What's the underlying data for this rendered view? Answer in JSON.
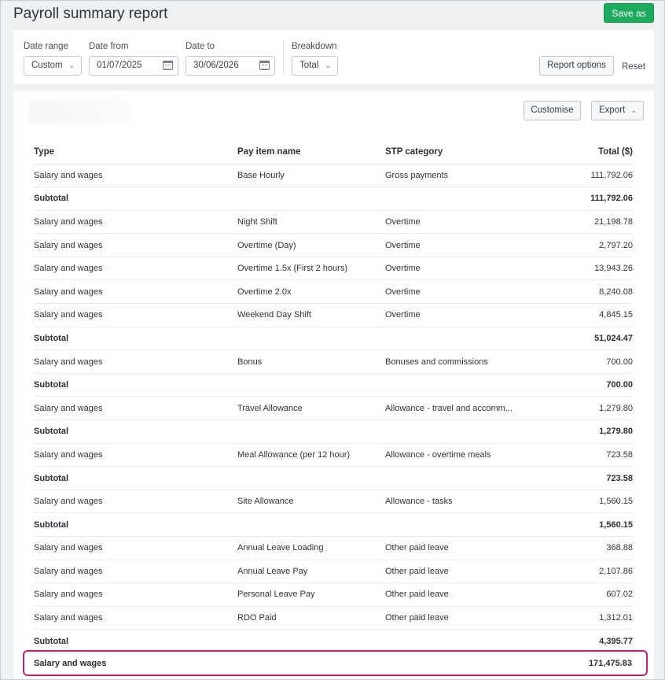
{
  "header": {
    "title": "Payroll summary report",
    "save_label": "Save as"
  },
  "filters": {
    "date_range": {
      "label": "Date range",
      "value": "Custom"
    },
    "date_from": {
      "label": "Date from",
      "value": "01/07/2025"
    },
    "date_to": {
      "label": "Date to",
      "value": "30/06/2026"
    },
    "breakdown": {
      "label": "Breakdown",
      "value": "Total"
    },
    "report_options_label": "Report options",
    "reset_label": "Reset"
  },
  "toolbar": {
    "customise_label": "Customise",
    "export_label": "Export"
  },
  "table": {
    "headers": [
      "Type",
      "Pay item name",
      "STP category",
      "Total ($)"
    ],
    "rows": [
      {
        "kind": "row",
        "type": "Salary and wages",
        "item": "Base Hourly",
        "stp": "Gross payments",
        "total": "111,792.06"
      },
      {
        "kind": "subtotal",
        "type": "Subtotal",
        "item": "",
        "stp": "",
        "total": "111,792.06"
      },
      {
        "kind": "row",
        "type": "Salary and wages",
        "item": "Night Shift",
        "stp": "Overtime",
        "total": "21,198.78"
      },
      {
        "kind": "row",
        "type": "Salary and wages",
        "item": "Overtime (Day)",
        "stp": "Overtime",
        "total": "2,797.20"
      },
      {
        "kind": "row",
        "type": "Salary and wages",
        "item": "Overtime 1.5x (First 2 hours)",
        "stp": "Overtime",
        "total": "13,943.26"
      },
      {
        "kind": "row",
        "type": "Salary and wages",
        "item": "Overtime 2.0x",
        "stp": "Overtime",
        "total": "8,240.08"
      },
      {
        "kind": "row",
        "type": "Salary and wages",
        "item": "Weekend Day Shift",
        "stp": "Overtime",
        "total": "4,845.15"
      },
      {
        "kind": "subtotal",
        "type": "Subtotal",
        "item": "",
        "stp": "",
        "total": "51,024.47"
      },
      {
        "kind": "row",
        "type": "Salary and wages",
        "item": "Bonus",
        "stp": "Bonuses and commissions",
        "total": "700.00"
      },
      {
        "kind": "subtotal",
        "type": "Subtotal",
        "item": "",
        "stp": "",
        "total": "700.00"
      },
      {
        "kind": "row",
        "type": "Salary and wages",
        "item": "Travel Allowance",
        "stp": "Allowance - travel and accomm...",
        "total": "1,279.80"
      },
      {
        "kind": "subtotal",
        "type": "Subtotal",
        "item": "",
        "stp": "",
        "total": "1,279.80"
      },
      {
        "kind": "row",
        "type": "Salary and wages",
        "item": "Meal Allowance (per 12 hour)",
        "stp": "Allowance - overtime meals",
        "total": "723.58"
      },
      {
        "kind": "subtotal",
        "type": "Subtotal",
        "item": "",
        "stp": "",
        "total": "723.58"
      },
      {
        "kind": "row",
        "type": "Salary and wages",
        "item": "Site Allowance",
        "stp": "Allowance - tasks",
        "total": "1,560.15"
      },
      {
        "kind": "subtotal",
        "type": "Subtotal",
        "item": "",
        "stp": "",
        "total": "1,560.15"
      },
      {
        "kind": "row",
        "type": "Salary and wages",
        "item": "Annual Leave Loading",
        "stp": "Other paid leave",
        "total": "368.88"
      },
      {
        "kind": "row",
        "type": "Salary and wages",
        "item": "Annual Leave Pay",
        "stp": "Other paid leave",
        "total": "2,107.86"
      },
      {
        "kind": "row",
        "type": "Salary and wages",
        "item": "Personal Leave Pay",
        "stp": "Other paid leave",
        "total": "607.02"
      },
      {
        "kind": "row",
        "type": "Salary and wages",
        "item": "RDO Paid",
        "stp": "Other paid leave",
        "total": "1,312.01"
      },
      {
        "kind": "subtotal",
        "type": "Subtotal",
        "item": "",
        "stp": "",
        "total": "4,395.77"
      }
    ],
    "grand_total": {
      "label": "Salary and wages",
      "total": "171,475.83"
    }
  }
}
